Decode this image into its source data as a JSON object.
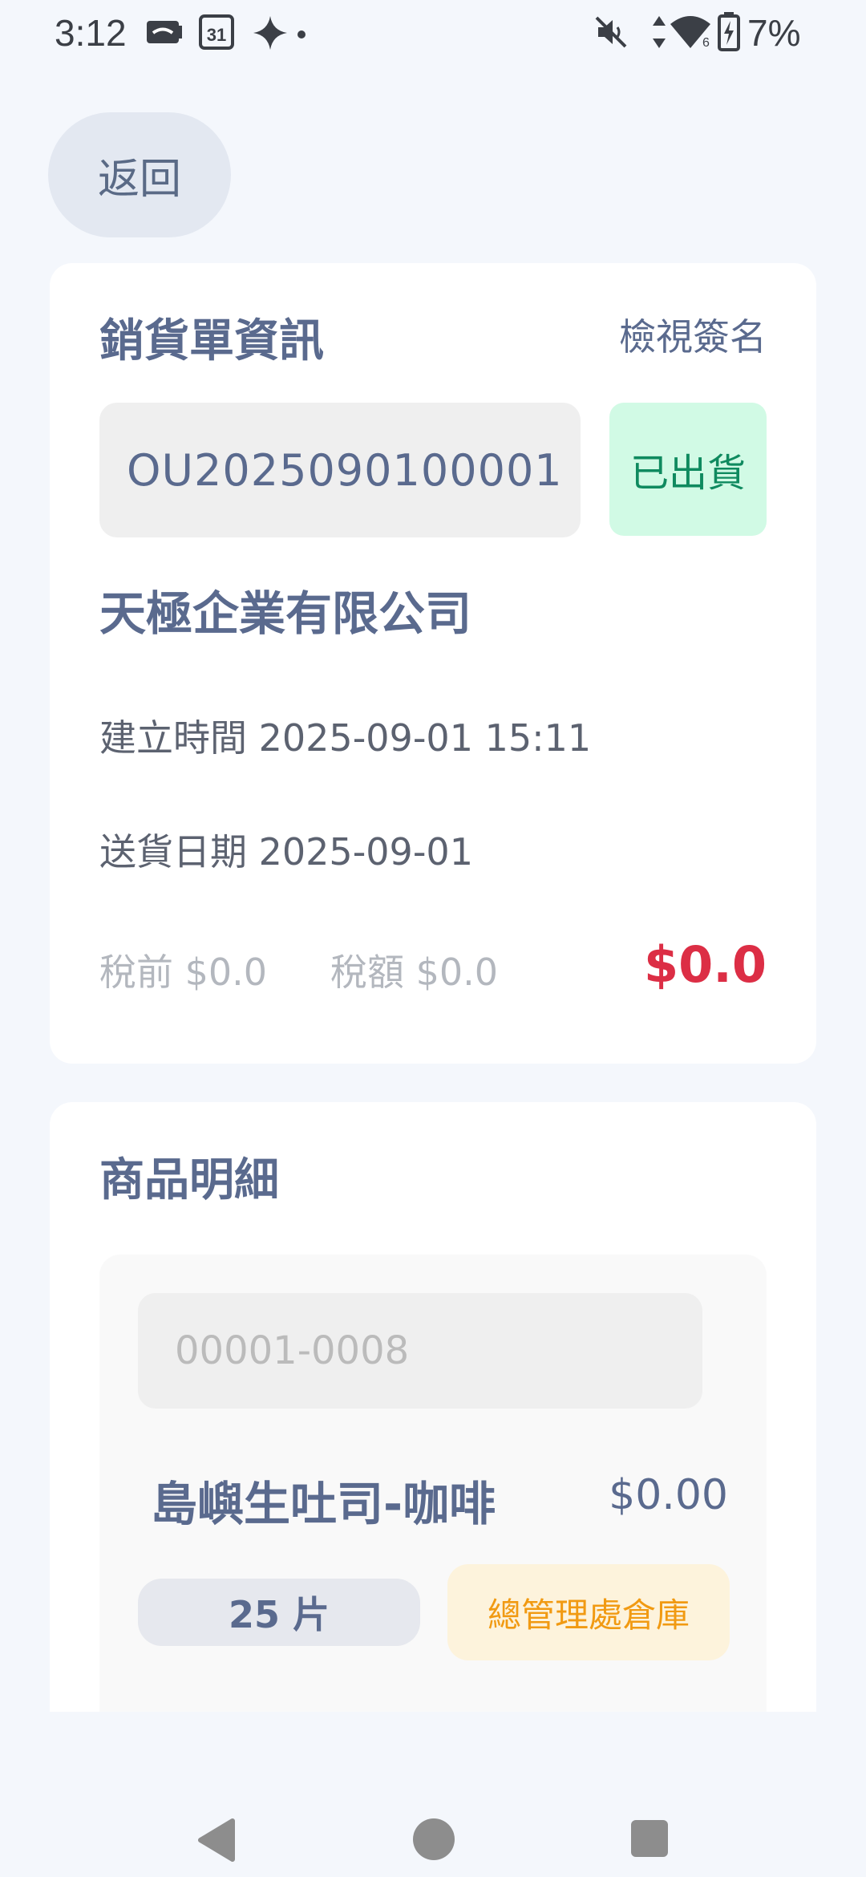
{
  "status_bar": {
    "time": "3:12",
    "battery_percent": "7%",
    "icons": [
      "cast-icon",
      "calendar-icon",
      "sparkle-icon",
      "dot-icon",
      "mute-icon",
      "data-arrows-icon",
      "wifi-icon",
      "battery-charging-icon"
    ],
    "calendar_day": "31",
    "wifi_badge": "6"
  },
  "header": {
    "back_label": "返回"
  },
  "order": {
    "section_title": "銷貨單資訊",
    "view_signature_label": "檢視簽名",
    "order_number": "OU2025090100001",
    "status_label": "已出貨",
    "status_color": "#0f8a5f",
    "company_name": "天極企業有限公司",
    "created_label": "建立時間",
    "created_value": "2025-09-01 15:11",
    "delivery_label": "送貨日期",
    "delivery_value": "2025-09-01",
    "pretax_label": "稅前",
    "pretax_value": "$0.0",
    "tax_label": "稅額",
    "tax_value": "$0.0",
    "total_value": "$0.0",
    "total_color": "#dc2e45"
  },
  "items": {
    "section_title": "商品明細",
    "list": [
      {
        "code": "00001-0008",
        "name": "島嶼生吐司-咖啡",
        "price": "$0.00",
        "quantity": "25 片",
        "warehouse": "總管理處倉庫"
      }
    ]
  },
  "nav_bar": {
    "buttons": [
      "back-triangle-icon",
      "home-circle-icon",
      "recents-square-icon"
    ]
  }
}
